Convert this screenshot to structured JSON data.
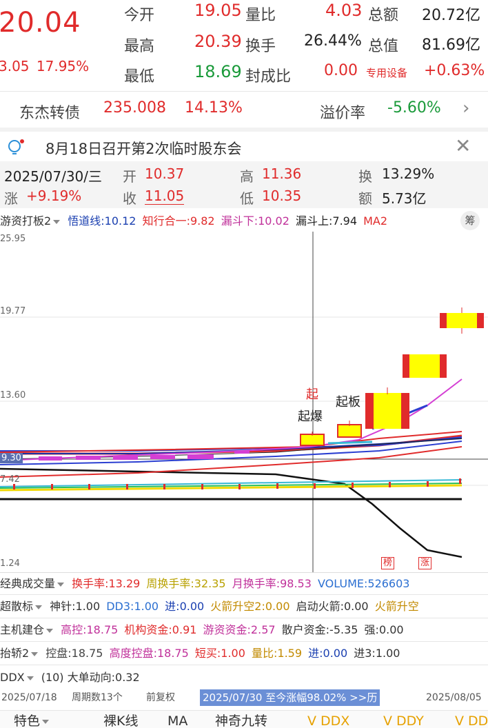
{
  "quote": {
    "price": "20.04",
    "change": "3.05",
    "change_pct": "17.95%",
    "rows": [
      {
        "l1": "今开",
        "v1": "19.05",
        "l2": "量比",
        "v2": "4.03",
        "l3": "总额",
        "v3": "20.72亿"
      },
      {
        "l1": "最高",
        "v1": "20.39",
        "l2": "换手",
        "v2": "26.44%",
        "l3": "总值",
        "v3": "81.69亿"
      },
      {
        "l1": "最低",
        "v1": "18.69",
        "l2": "封成比",
        "v2": "0.00",
        "l3": "专用设备",
        "v3": "+0.63%"
      }
    ]
  },
  "bond": {
    "name": "东杰转债",
    "price": "235.008",
    "pct": "14.13%",
    "premium_label": "溢价率",
    "premium": "-5.60%"
  },
  "notice": {
    "text": "8月18日召开第2次临时股东会"
  },
  "day_info": {
    "date": "2025/07/30/三",
    "open_label": "开",
    "open": "10.37",
    "high_label": "高",
    "high": "11.36",
    "turn_label": "换",
    "turn": "13.29%",
    "rise_label": "涨",
    "rise": "+9.19%",
    "close_label": "收",
    "close": "11.05",
    "low_label": "低",
    "low": "10.35",
    "amt_label": "额",
    "amt": "5.73亿"
  },
  "indicator_bar": {
    "name": "游资打板2",
    "wudao": "悟道线:10.12",
    "zhixing": "知行合一:9.82",
    "loudou_down": "漏斗下:10.02",
    "loudou_up": "漏斗上:7.94",
    "ma": "MA2",
    "icon_text": "筹"
  },
  "chart": {
    "y_ticks": [
      "25.95",
      "19.77",
      "13.60",
      "9.30",
      "7.42",
      "1.24"
    ],
    "labels": {
      "qi": "起",
      "qibao": "起爆",
      "qiban": "起板",
      "bang": "榜",
      "zhang": "涨"
    }
  },
  "panels": [
    {
      "name": "经典成交量",
      "items": [
        {
          "t": "换手率:13.29",
          "c": "#e02b2b"
        },
        {
          "t": "周换手率:32.35",
          "c": "#b8a100"
        },
        {
          "t": "月换手率:98.53",
          "c": "#c0309a"
        },
        {
          "t": "VOLUME:526603",
          "c": "#2b6fd1"
        }
      ]
    },
    {
      "name": "超散标",
      "items": [
        {
          "t": "神针:1.00",
          "c": "#333"
        },
        {
          "t": "DD3:1.00",
          "c": "#2b6fd1"
        },
        {
          "t": "进:0.00",
          "c": "#1a3fb0"
        },
        {
          "t": "火箭升空2:0.00",
          "c": "#c28a00"
        },
        {
          "t": "启动火箭:0.00",
          "c": "#333"
        },
        {
          "t": "火箭升空",
          "c": "#c28a00"
        }
      ]
    },
    {
      "name": "主机建仓",
      "items": [
        {
          "t": "高控:18.75",
          "c": "#c0309a"
        },
        {
          "t": "机构资金:0.91",
          "c": "#e02b2b"
        },
        {
          "t": "游资资金:2.57",
          "c": "#c0309a"
        },
        {
          "t": "散户资金:-5.35",
          "c": "#333"
        },
        {
          "t": "强:0.00",
          "c": "#333"
        }
      ]
    },
    {
      "name": "抬轿2",
      "items": [
        {
          "t": "控盘:18.75",
          "c": "#444"
        },
        {
          "t": "高度控盘:18.75",
          "c": "#c0309a"
        },
        {
          "t": "短买:1.00",
          "c": "#e02b2b"
        },
        {
          "t": "量比:1.59",
          "c": "#c28a00"
        },
        {
          "t": "进:0.00",
          "c": "#1a3fb0"
        },
        {
          "t": "进3:1.00",
          "c": "#333"
        }
      ]
    },
    {
      "name": "DDX",
      "items": [
        {
          "t": "(10) 大单动向:0.32",
          "c": "#333"
        }
      ]
    }
  ],
  "footer": {
    "start": "2025/07/18",
    "period": "周期数13个",
    "fq": "前复权",
    "range": "2025/07/30 至今涨幅98.02% >>历",
    "end": "2025/08/05"
  },
  "tabs": [
    "特色",
    "裸K线",
    "MA",
    "神奇九转",
    "DDX",
    "DDY",
    "DD"
  ]
}
